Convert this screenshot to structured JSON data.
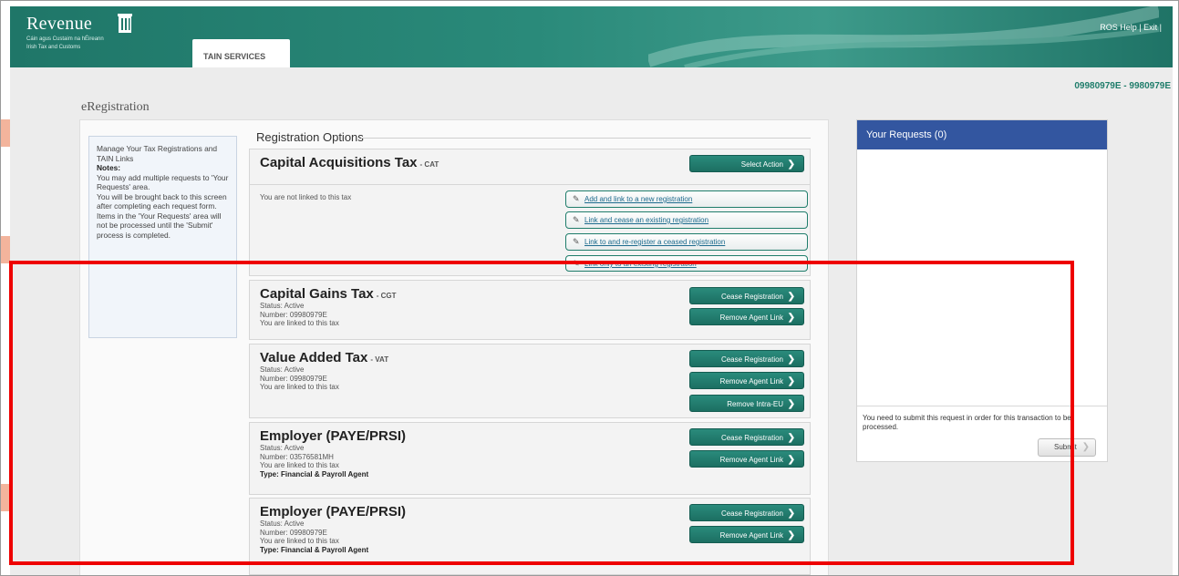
{
  "header": {
    "logo_word": "Revenue",
    "logo_sub_1": "Cáin agus Custaim na hÉireann",
    "logo_sub_2": "Irish Tax and Customs",
    "tab_label": "TAIN SERVICES",
    "help_link": "ROS Help",
    "exit_link": "Exit",
    "separator": "|"
  },
  "user_id": "09980979E - 9980979E",
  "page_title": "eRegistration",
  "notes": {
    "line1": "Manage Your Tax Registrations and TAIN Links",
    "heading": "Notes:",
    "p1": "You may add multiple requests to 'Your Requests' area.",
    "p2": "You will be brought back to this screen after completing each request form.",
    "p3": "Items in the 'Your Requests' area will not be processed until the 'Submit' process is completed."
  },
  "registration_title": "Registration Options",
  "cat": {
    "title": "Capital Acquisitions Tax",
    "code": "- CAT",
    "action_label": "Select Action",
    "not_linked": "You are not linked to this tax",
    "options": [
      "Add and link to a new registration",
      "Link and cease an existing registration",
      "Link to and re-register a ceased registration",
      "Link only to an existing registration"
    ]
  },
  "cgt": {
    "title": "Capital Gains Tax",
    "code": "- CGT",
    "status": "Status: Active",
    "number": "Number: 09980979E",
    "linked": "You are linked to this tax",
    "btn1": "Cease Registration",
    "btn2": "Remove Agent Link"
  },
  "vat": {
    "title": "Value Added Tax",
    "code": "- VAT",
    "status": "Status: Active",
    "number": "Number: 09980979E",
    "linked": "You are linked to this tax",
    "btn1": "Cease Registration",
    "btn2": "Remove Agent Link",
    "btn3": "Remove Intra-EU"
  },
  "paye1": {
    "title": "Employer (PAYE/PRSI)",
    "status": "Status: Active",
    "number": "Number: 03576581MH",
    "linked": "You are linked to this tax",
    "type": "Type: Financial & Payroll Agent",
    "btn1": "Cease Registration",
    "btn2": "Remove Agent Link"
  },
  "paye2": {
    "title": "Employer (PAYE/PRSI)",
    "status": "Status: Active",
    "number": "Number: 09980979E",
    "linked": "You are linked to this tax",
    "type": "Type: Financial & Payroll Agent",
    "btn1": "Cease Registration",
    "btn2": "Remove Agent Link"
  },
  "requests": {
    "title": "Your Requests (0)",
    "footer": "You need to submit this request in order for this transaction to be processed.",
    "submit_label": "Submit"
  },
  "colors": {
    "teal": "#1f7668",
    "blue_head": "#3356a0",
    "highlight": "#ee0000"
  },
  "icons": [
    "harp-icon",
    "pencil-icon",
    "chevron-right-icon"
  ]
}
